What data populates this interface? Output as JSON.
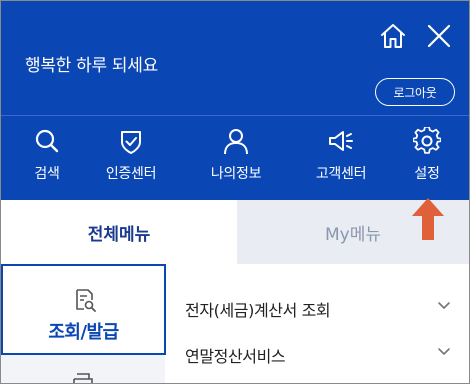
{
  "header": {
    "greeting": "행복한 하루 되세요",
    "logout_label": "로그아웃"
  },
  "quick_menu": [
    {
      "label": "검색",
      "icon": "search-icon"
    },
    {
      "label": "인증센터",
      "icon": "shield-check-icon"
    },
    {
      "label": "나의정보",
      "icon": "person-icon"
    },
    {
      "label": "고객센터",
      "icon": "megaphone-icon"
    },
    {
      "label": "설정",
      "icon": "gear-icon"
    }
  ],
  "tabs": [
    {
      "label": "전체메뉴",
      "active": true
    },
    {
      "label": "My메뉴",
      "active": false
    }
  ],
  "categories": [
    {
      "label": "조회/발급",
      "icon": "document-search-icon",
      "selected": true
    },
    {
      "label": "",
      "icon": "printer-icon",
      "selected": false
    }
  ],
  "menu_items": [
    {
      "label": "전자(세금)계산서 조회"
    },
    {
      "label": "연말정산서비스"
    }
  ],
  "colors": {
    "header_bg": "#0a47b4",
    "active_tab_text": "#1b3c8c",
    "inactive_tab_bg": "#e9edf3",
    "annotation_arrow": "#e0603a"
  }
}
